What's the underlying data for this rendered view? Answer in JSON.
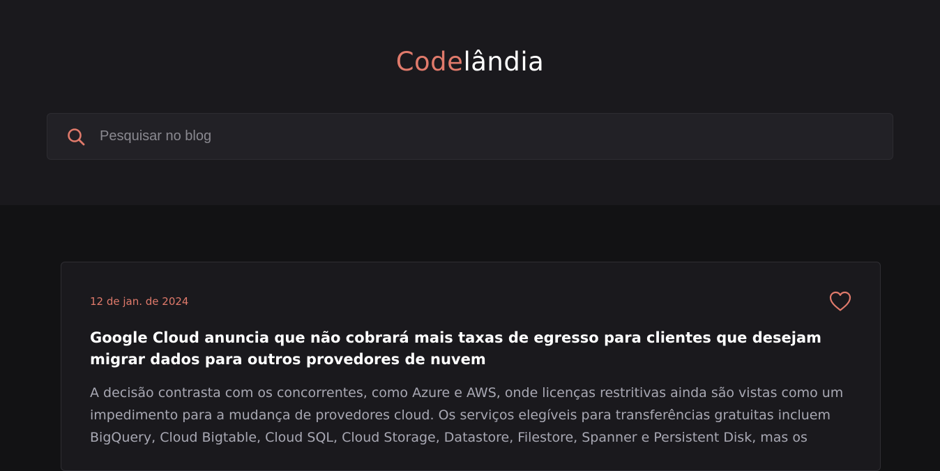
{
  "header": {
    "logo_accent": "Code",
    "logo_rest": "lândia"
  },
  "search": {
    "placeholder": "Pesquisar no blog",
    "value": "",
    "icon": "search-icon"
  },
  "post": {
    "date": "12 de jan. de 2024",
    "title": "Google Cloud anuncia que não cobrará mais taxas de egresso para clientes que desejam migrar dados para outros provedores de nuvem",
    "excerpt": "A decisão contrasta com os concorrentes, como Azure e AWS, onde licenças restritivas ainda são vistas como um impedimento para a mudança de provedores cloud. Os serviços elegíveis para transferências gratuitas incluem BigQuery, Cloud Bigtable, Cloud SQL, Cloud Storage, Datastore, Filestore, Spanner e Persistent Disk, mas os",
    "like_icon": "heart-icon"
  },
  "colors": {
    "accent": "#e07a6b",
    "header_bg": "#1a191d",
    "page_bg": "#121214",
    "card_bg": "#1a191d"
  }
}
